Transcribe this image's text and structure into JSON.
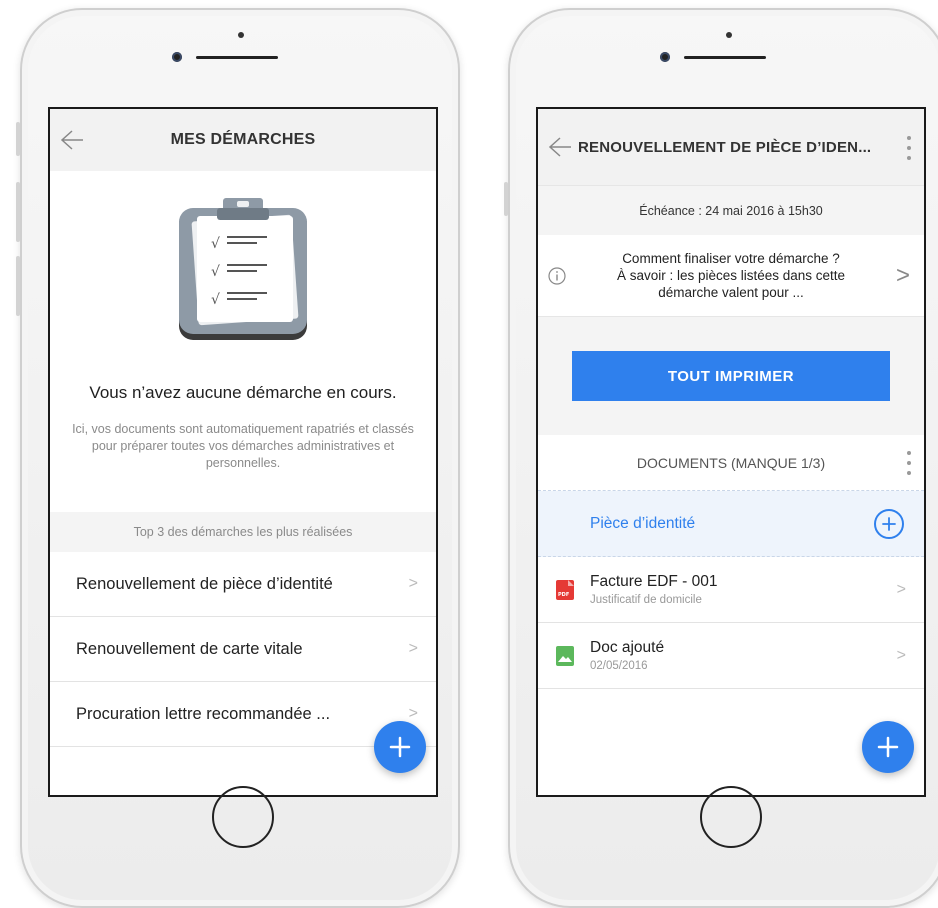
{
  "left": {
    "header": {
      "title": "MES DÉMARCHES"
    },
    "empty": {
      "title": "Vous n’avez aucune démarche en cours.",
      "description": "Ici, vos documents sont automatiquement rapatriés et classés pour préparer toutes vos démarches administratives et personnelles."
    },
    "top": {
      "heading": "Top 3 des démarches les plus réalisées",
      "items": [
        {
          "label": "Renouvellement de pièce d’identité"
        },
        {
          "label": "Renouvellement de carte vitale"
        },
        {
          "label": "Procuration lettre recommandée ..."
        }
      ]
    },
    "fab_icon": "plus-icon"
  },
  "right": {
    "header": {
      "title": "RENOUVELLEMENT DE PIÈCE D’IDEN..."
    },
    "deadline": "Échéance : 24 mai 2016 à 15h30",
    "info": {
      "line1": "Comment finaliser votre démarche ?",
      "line2": "À savoir : les pièces listées dans cette",
      "line3": "démarche valent pour ..."
    },
    "print_label": "TOUT IMPRIMER",
    "documents": {
      "heading": "DOCUMENTS (MANQUE 1/3)",
      "missing": "Pièce d’identité",
      "items": [
        {
          "title": "Facture EDF - 001",
          "subtitle": "Justificatif de domicile",
          "icon": "pdf-icon"
        },
        {
          "title": "Doc ajouté",
          "subtitle": "02/05/2016",
          "icon": "image-icon"
        }
      ]
    },
    "fab_icon": "plus-icon"
  },
  "colors": {
    "accent": "#2f80ed",
    "pdf": "#e53935",
    "image": "#5cb85c"
  }
}
